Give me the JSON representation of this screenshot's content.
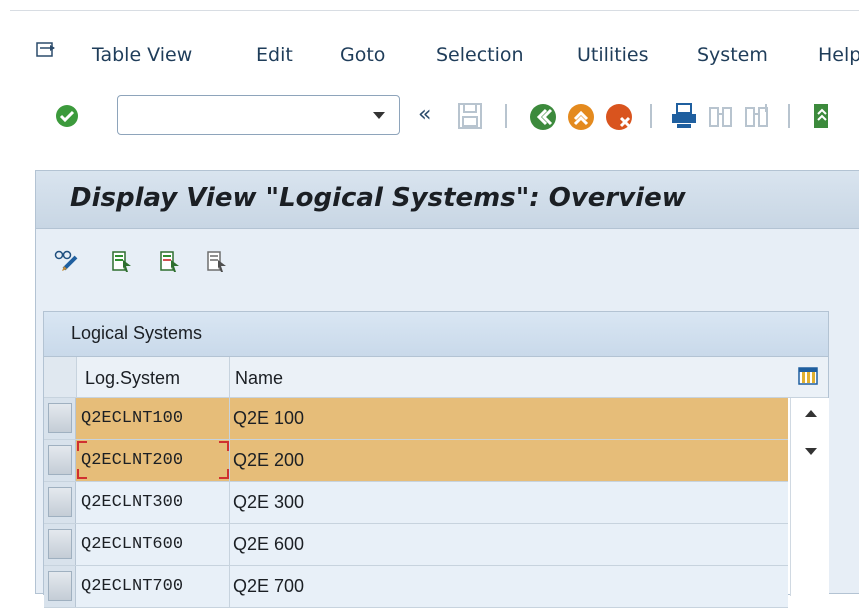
{
  "menubar": {
    "items": [
      {
        "label": "Table View"
      },
      {
        "label": "Edit"
      },
      {
        "label": "Goto"
      },
      {
        "label": "Selection"
      },
      {
        "label": "Utilities"
      },
      {
        "label": "System"
      },
      {
        "label": "Help"
      }
    ]
  },
  "toolbar": {
    "command_field_value": "",
    "prev_glyph": "«"
  },
  "page": {
    "title": "Display View \"Logical Systems\": Overview"
  },
  "table": {
    "title": "Logical Systems",
    "columns": [
      "Log.System",
      "Name"
    ],
    "rows": [
      {
        "code": "Q2ECLNT100",
        "name": "Q2E 100",
        "highlighted": true
      },
      {
        "code": "Q2ECLNT200",
        "name": "Q2E 200",
        "highlighted": true,
        "focused": true
      },
      {
        "code": "Q2ECLNT300",
        "name": "Q2E 300",
        "highlighted": false
      },
      {
        "code": "Q2ECLNT600",
        "name": "Q2E 600",
        "highlighted": false
      },
      {
        "code": "Q2ECLNT700",
        "name": "Q2E 700",
        "highlighted": false
      }
    ]
  },
  "colors": {
    "highlight_row": "#e6bd79",
    "plain_row": "#e8f0f8",
    "focus_border": "#d03030"
  }
}
